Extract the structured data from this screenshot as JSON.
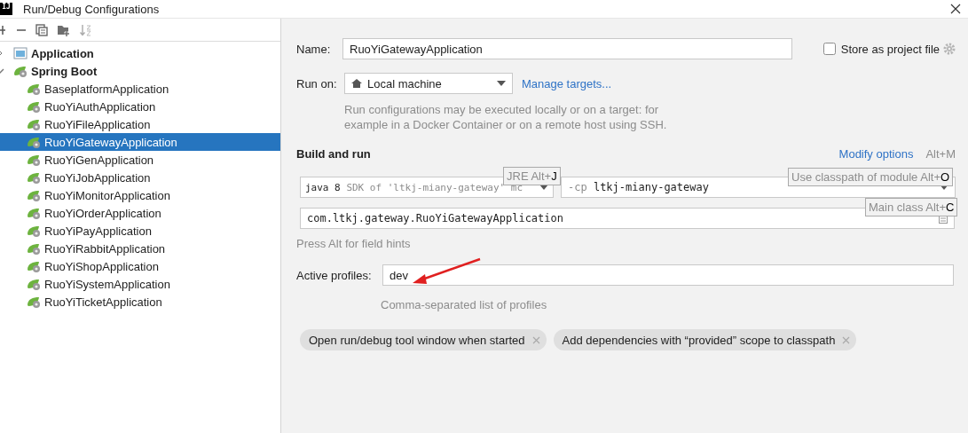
{
  "window": {
    "icon_text": "IJ",
    "title": "Run/Debug Configurations"
  },
  "tree": [
    {
      "label": "Application",
      "kind": "application",
      "expanded": false,
      "selected": false
    },
    {
      "label": "Spring Boot",
      "kind": "spring",
      "expanded": true,
      "selected": false,
      "children": [
        {
          "label": "BaseplatformApplication",
          "kind": "spring",
          "selected": false
        },
        {
          "label": "RuoYiAuthApplication",
          "kind": "spring",
          "selected": false
        },
        {
          "label": "RuoYiFileApplication",
          "kind": "spring",
          "selected": false
        },
        {
          "label": "RuoYiGatewayApplication",
          "kind": "spring",
          "selected": true
        },
        {
          "label": "RuoYiGenApplication",
          "kind": "spring",
          "selected": false
        },
        {
          "label": "RuoYiJobApplication",
          "kind": "spring",
          "selected": false
        },
        {
          "label": "RuoYiMonitorApplication",
          "kind": "spring",
          "selected": false
        },
        {
          "label": "RuoYiOrderApplication",
          "kind": "spring",
          "selected": false
        },
        {
          "label": "RuoYiPayApplication",
          "kind": "spring",
          "selected": false
        },
        {
          "label": "RuoYiRabbitApplication",
          "kind": "spring",
          "selected": false
        },
        {
          "label": "RuoYiShopApplication",
          "kind": "spring",
          "selected": false
        },
        {
          "label": "RuoYiSystemApplication",
          "kind": "spring",
          "selected": false
        },
        {
          "label": "RuoYiTicketApplication",
          "kind": "spring",
          "selected": false
        }
      ]
    }
  ],
  "form": {
    "name_label": "Name:",
    "name_value": "RuoYiGatewayApplication",
    "store_label": "Store as project file",
    "store_checked": false,
    "run_on_label": "Run on:",
    "run_on_value": "Local machine",
    "manage_link": "Manage targets...",
    "run_on_help": [
      "Run configurations may be executed locally or on a target: for",
      "example in a Docker Container or on a remote host using SSH."
    ],
    "build_title": "Build and run",
    "modify_options": "Modify options",
    "modify_shortcut": "Alt+M",
    "jre_version": "java 8",
    "jre_detail": "SDK of 'ltkj-miany-gateway' mc",
    "cp_flag": "-cp",
    "cp_module": "ltkj-miany-gateway",
    "main_class": "com.ltkj.gateway.RuoYiGatewayApplication",
    "field_hint": "Press Alt for field hints",
    "profiles_label": "Active profiles:",
    "profiles_value": "dev",
    "profiles_hint": "Comma-separated list of profiles",
    "options": [
      "Open run/debug tool window when started",
      "Add dependencies with “provided” scope to classpath"
    ]
  },
  "tooltips": [
    {
      "kind": "jre",
      "text": "JRE Alt+**J**"
    },
    {
      "kind": "classpath",
      "text": "Use classpath of module Alt+**O**"
    },
    {
      "kind": "main",
      "text": "Main class Alt+**C**"
    }
  ]
}
